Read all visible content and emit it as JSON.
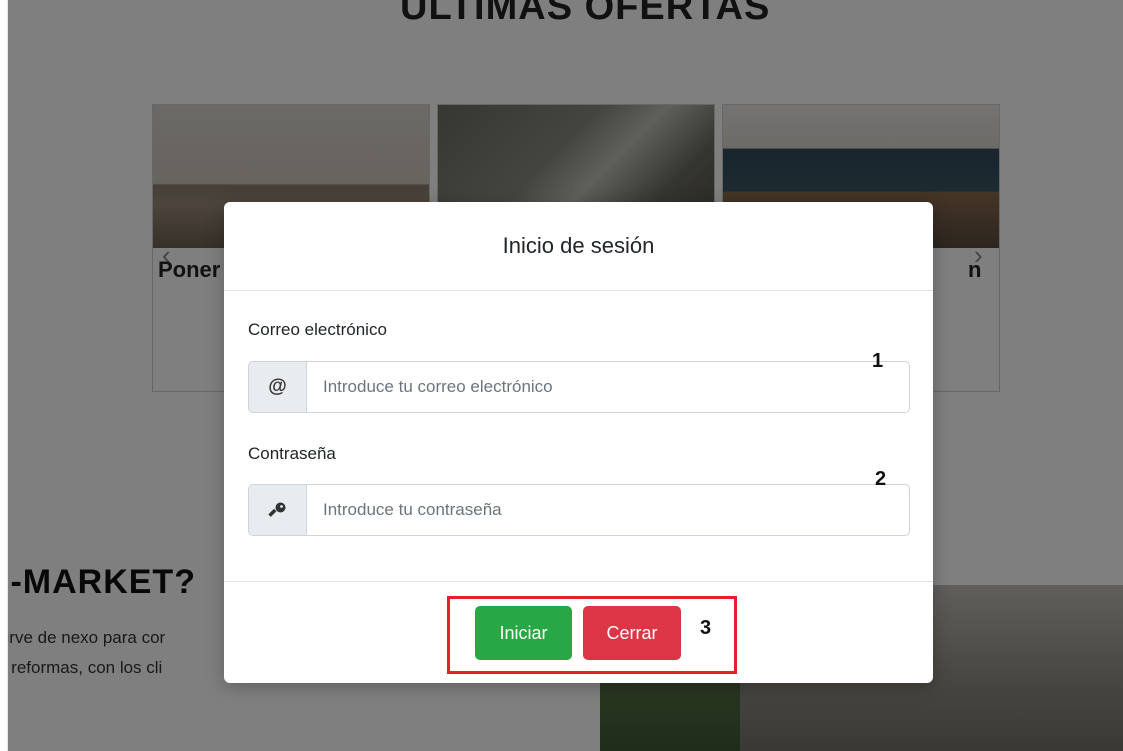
{
  "background": {
    "section_title": "ÚLTIMAS OFERTAS",
    "cards": [
      {
        "title": "Poner"
      },
      {
        "title": ""
      },
      {
        "title": "n"
      }
    ],
    "carousel_prev": "‹",
    "carousel_next": "›",
    "about_title": "O-MARKET?",
    "about_line1": "sirve de nexo para cor",
    "about_line2": "e reformas, con los cli"
  },
  "modal": {
    "title": "Inicio de sesión",
    "email": {
      "label": "Correo electrónico",
      "icon_glyph": "@",
      "placeholder": "Introduce tu correo electrónico",
      "value": "",
      "annotation": "1"
    },
    "password": {
      "label": "Contraseña",
      "icon_glyph": "🔑",
      "placeholder": "Introduce tu contraseña",
      "value": "",
      "annotation": "2"
    },
    "footer": {
      "submit_label": "Iniciar",
      "close_label": "Cerrar",
      "annotation": "3"
    }
  },
  "colors": {
    "success": "#28a745",
    "danger": "#dc3545",
    "highlight": "#e5202a",
    "overlay": "rgba(0,0,0,0.5)"
  }
}
